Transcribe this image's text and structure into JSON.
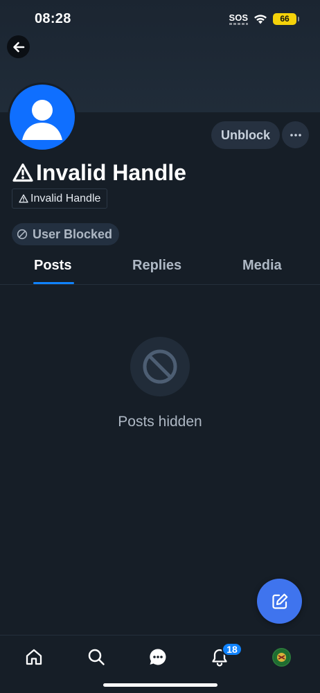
{
  "status_bar": {
    "time": "08:28",
    "sos": "SOS",
    "battery": "66"
  },
  "profile": {
    "display_name": "Invalid Handle",
    "handle": "Invalid Handle",
    "blocked_label": "User Blocked",
    "unblock_label": "Unblock"
  },
  "tabs": [
    {
      "label": "Posts",
      "active": true
    },
    {
      "label": "Replies",
      "active": false
    },
    {
      "label": "Media",
      "active": false
    }
  ],
  "empty_state": {
    "label": "Posts hidden",
    "icon": "ban-icon"
  },
  "bottom_nav": {
    "items": [
      "home-icon",
      "search-icon",
      "chat-icon",
      "bell-icon",
      "avatar"
    ],
    "notifications_badge": "18"
  },
  "colors": {
    "accent": "#1083fe",
    "fab": "#3f74ee",
    "background": "#161e27",
    "avatar": "#0f6fff"
  }
}
